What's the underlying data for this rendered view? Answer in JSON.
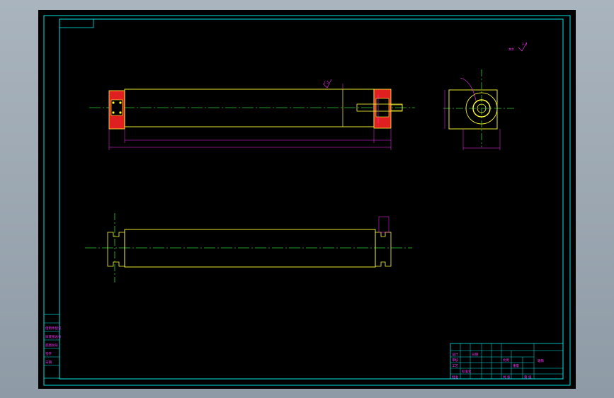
{
  "colors": {
    "background": "#000000",
    "frame": "#00e5e5",
    "outline": "#ffff33",
    "centerline": "#33cc33",
    "dimension": "#ff33ff",
    "section_fill": "#e02020"
  },
  "annotations": {
    "surface_roughness_value": "3.2",
    "surface_roughness_note": "其余",
    "taper_note": "1:5"
  },
  "title_block": {
    "cells": [
      "设计",
      "审核",
      "工艺",
      "标准化",
      "批准",
      "日期",
      "比例",
      "重量",
      "共 张",
      "第 张"
    ],
    "drawing_name": "辊筒"
  },
  "revision_column": {
    "cells": [
      "借用件登记",
      "旧底图总号",
      "底图总号",
      "签字",
      "日期"
    ]
  }
}
